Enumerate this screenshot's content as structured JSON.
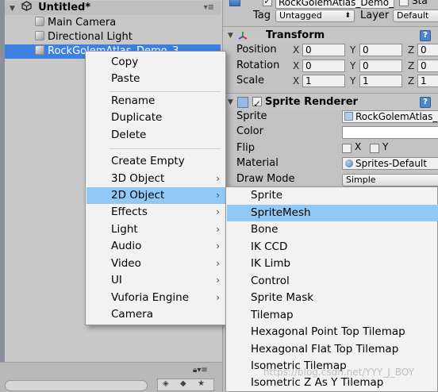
{
  "hierarchy": {
    "scene_title": "Untitled*",
    "items": [
      {
        "label": "Main Camera"
      },
      {
        "label": "Directional Light"
      },
      {
        "label": "RockGolemAtlas_Demo_3"
      }
    ],
    "menu_icon": "kebab-menu-icon"
  },
  "inspector": {
    "object_name": "RockGolemAtlas_Demo_",
    "static_label": "Sta",
    "tag_label": "Tag",
    "tag_value": "Untagged",
    "layer_label": "Layer",
    "layer_value": "Default",
    "transform": {
      "title": "Transform",
      "position_label": "Position",
      "rotation_label": "Rotation",
      "scale_label": "Scale",
      "x_axis": "X",
      "y_axis": "Y",
      "z_axis": "Z",
      "position": {
        "x": "0",
        "y": "0",
        "z": "0"
      },
      "rotation": {
        "x": "0",
        "y": "0",
        "z": "0"
      },
      "scale": {
        "x": "1",
        "y": "1",
        "z": "1"
      }
    },
    "sprite_renderer": {
      "title": "Sprite Renderer",
      "sprite_label": "Sprite",
      "sprite_value": "RockGolemAtlas_",
      "color_label": "Color",
      "flip_label": "Flip",
      "flip_x": "X",
      "flip_y": "Y",
      "material_label": "Material",
      "material_value": "Sprites-Default",
      "draw_mode_label": "Draw Mode",
      "draw_mode_value": "Simple"
    }
  },
  "context_menu": {
    "items": [
      {
        "label": "Copy",
        "submenu": false
      },
      {
        "label": "Paste",
        "submenu": false
      },
      {
        "label": "Rename",
        "submenu": false
      },
      {
        "label": "Duplicate",
        "submenu": false
      },
      {
        "label": "Delete",
        "submenu": false
      },
      {
        "label": "Create Empty",
        "submenu": false
      },
      {
        "label": "3D Object",
        "submenu": true
      },
      {
        "label": "2D Object",
        "submenu": true,
        "highlighted": true
      },
      {
        "label": "Effects",
        "submenu": true
      },
      {
        "label": "Light",
        "submenu": true
      },
      {
        "label": "Audio",
        "submenu": true
      },
      {
        "label": "Video",
        "submenu": true
      },
      {
        "label": "UI",
        "submenu": true
      },
      {
        "label": "Vuforia Engine",
        "submenu": true
      },
      {
        "label": "Camera",
        "submenu": false
      }
    ],
    "arrow": "›"
  },
  "submenu_2d": {
    "items": [
      {
        "label": "Sprite"
      },
      {
        "label": "SpriteMesh",
        "highlighted": true
      },
      {
        "label": "Bone"
      },
      {
        "label": "IK CCD"
      },
      {
        "label": "IK Limb"
      },
      {
        "label": "Control"
      },
      {
        "label": "Sprite Mask"
      },
      {
        "label": "Tilemap"
      },
      {
        "label": "Hexagonal Point Top Tilemap"
      },
      {
        "label": "Hexagonal Flat Top Tilemap"
      },
      {
        "label": "Isometric Tilemap"
      },
      {
        "label": "Isometric Z As Y Tilemap"
      }
    ]
  },
  "watermark": "https://blog.csdn.net/YYY_J_BOY",
  "colors": {
    "selection": "#3d80df",
    "menu_highlight": "#90c8f6",
    "menu_bg": "#f2f2f2",
    "panel_bg": "#c2c2c2"
  }
}
